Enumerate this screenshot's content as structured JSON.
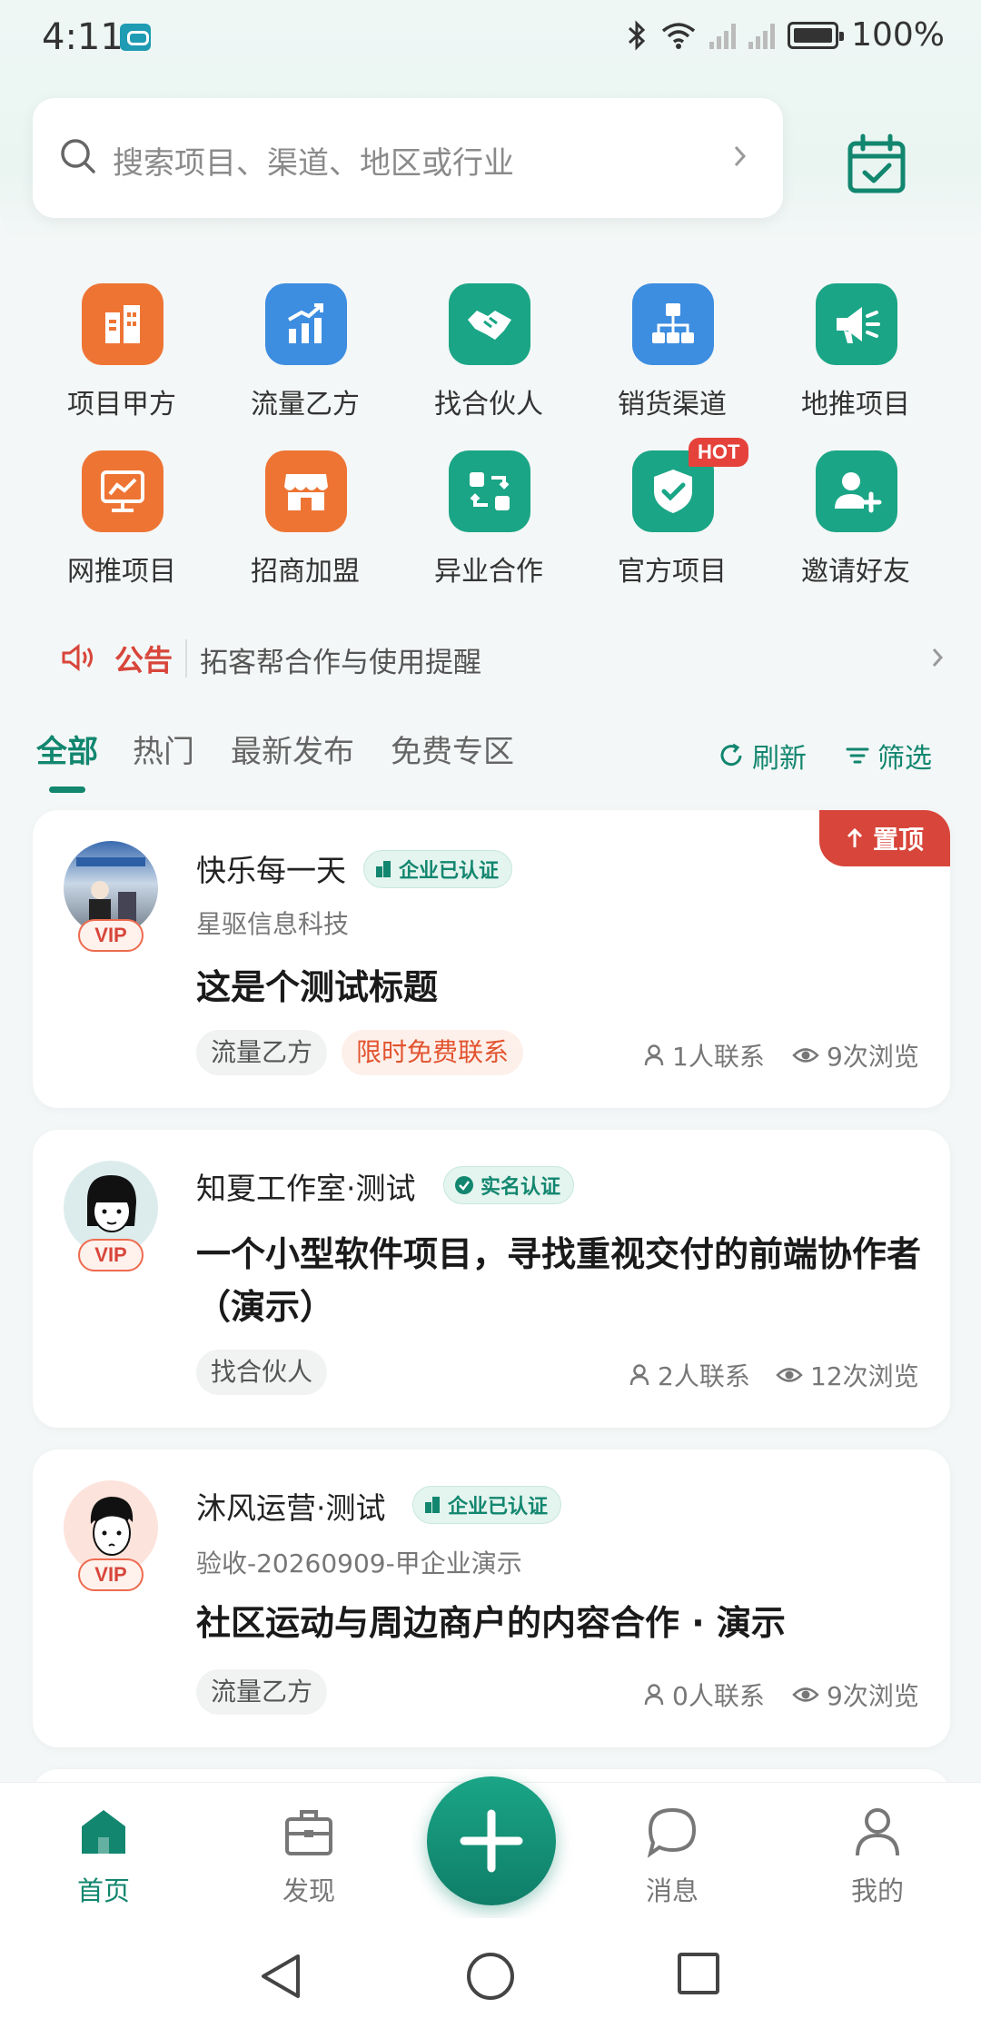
{
  "status_bar": {
    "time": "4:11",
    "battery": "100%"
  },
  "search": {
    "placeholder": "搜索项目、渠道、地区或行业"
  },
  "grid": [
    {
      "label": "项目甲方",
      "icon": "building-icon",
      "color": "#ee7434"
    },
    {
      "label": "流量乙方",
      "icon": "chart-up-icon",
      "color": "#3d8de0"
    },
    {
      "label": "找合伙人",
      "icon": "handshake-icon",
      "color": "#1aa586"
    },
    {
      "label": "销货渠道",
      "icon": "org-chart-icon",
      "color": "#3d8de0"
    },
    {
      "label": "地推项目",
      "icon": "megaphone-icon",
      "color": "#1aa586"
    },
    {
      "label": "网推项目",
      "icon": "screen-chart-icon",
      "color": "#ee7434"
    },
    {
      "label": "招商加盟",
      "icon": "store-icon",
      "color": "#ee7434"
    },
    {
      "label": "异业合作",
      "icon": "exchange-icon",
      "color": "#1aa586"
    },
    {
      "label": "官方项目",
      "icon": "shield-check-icon",
      "color": "#1aa586",
      "badge": "HOT"
    },
    {
      "label": "邀请好友",
      "icon": "add-user-icon",
      "color": "#1aa586"
    }
  ],
  "notice": {
    "tag": "公告",
    "text": "拓客帮合作与使用提醒"
  },
  "tabs": {
    "items": [
      "全部",
      "热门",
      "最新发布",
      "免费专区"
    ],
    "active": 0,
    "refresh": "刷新",
    "filter": "筛选"
  },
  "cards": [
    {
      "name": "快乐每一天",
      "badge": "企业已认证",
      "badge_icon": "building-icon",
      "vip": "VIP",
      "company": "星驱信息科技",
      "title": "这是个测试标题",
      "chips": [
        "流量乙方",
        "限时免费联系"
      ],
      "contacts": "1人联系",
      "views": "9次浏览",
      "pin": "置顶"
    },
    {
      "name": "知夏工作室·测试",
      "badge": "实名认证",
      "badge_icon": "check-circle-icon",
      "vip": "VIP",
      "title": "一个小型软件项目，寻找重视交付的前端协作者（演示）",
      "chips": [
        "找合伙人"
      ],
      "contacts": "2人联系",
      "views": "12次浏览"
    },
    {
      "name": "沐风运营·测试",
      "badge": "企业已认证",
      "badge_icon": "building-icon",
      "vip": "VIP",
      "company": "验收-20260909-甲企业演示",
      "title": "社区运动与周边商户的内容合作 · 演示",
      "chips": [
        "流量乙方"
      ],
      "contacts": "0人联系",
      "views": "9次浏览"
    }
  ],
  "bottom_nav": [
    {
      "label": "首页",
      "icon": "home-icon",
      "active": true
    },
    {
      "label": "发现",
      "icon": "briefcase-icon"
    },
    {
      "label": "消息",
      "icon": "chat-icon"
    },
    {
      "label": "我的",
      "icon": "user-icon"
    }
  ],
  "colors": {
    "brand": "#12866f",
    "accent_red": "#d8453a"
  }
}
